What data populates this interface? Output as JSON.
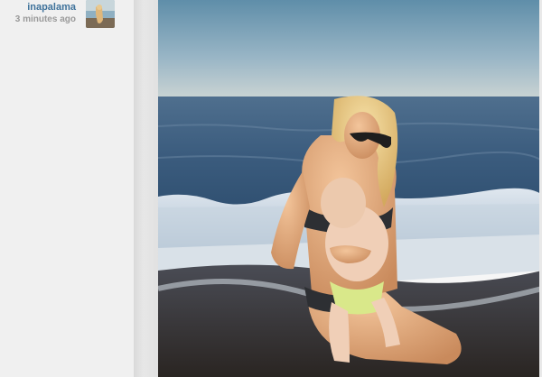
{
  "post": {
    "username": "inapalama",
    "timestamp": "3 minutes ago"
  },
  "icons": {
    "avatar": "user-avatar-thumbnail",
    "photo": "post-photo"
  },
  "colors": {
    "username": "#3f729b",
    "timestamp": "#9a9a9a",
    "sky_top": "#5a8aa8",
    "sea": "#3a5e80"
  }
}
